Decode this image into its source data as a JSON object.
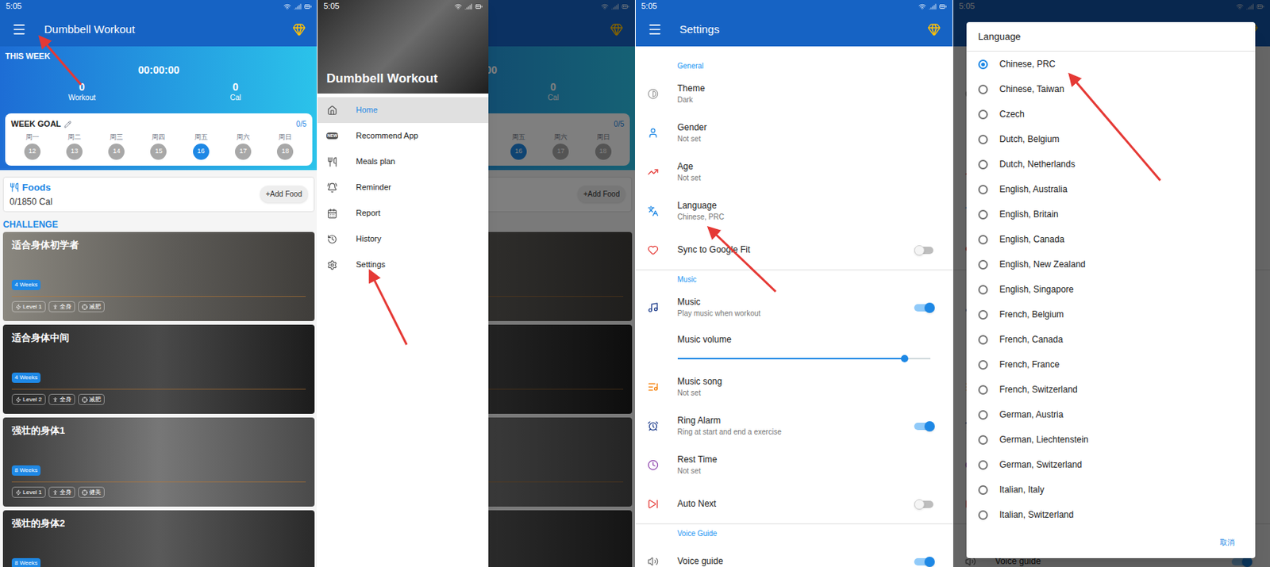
{
  "status_bar": {
    "time": "5:05"
  },
  "home": {
    "title": "Dumbbell Workout",
    "this_week": {
      "label": "THIS WEEK",
      "duration": "00:00:00",
      "stats": [
        {
          "value": "0",
          "label": "Workout"
        },
        {
          "value": "0",
          "label": "Cal"
        }
      ]
    },
    "week_goal": {
      "label": "WEEK GOAL",
      "progress": "0/5",
      "days": [
        {
          "name": "周一",
          "date": "12",
          "selected": false
        },
        {
          "name": "周二",
          "date": "13",
          "selected": false
        },
        {
          "name": "周三",
          "date": "14",
          "selected": false
        },
        {
          "name": "周四",
          "date": "15",
          "selected": false
        },
        {
          "name": "周五",
          "date": "16",
          "selected": true
        },
        {
          "name": "周六",
          "date": "17",
          "selected": false
        },
        {
          "name": "周日",
          "date": "18",
          "selected": false
        }
      ]
    },
    "foods": {
      "label": "Foods",
      "calories": "0/1850 Cal",
      "button": "+Add Food"
    },
    "challenge": {
      "label": "CHALLENGE",
      "cards": [
        {
          "title": "适合身体初学者",
          "duration": "4 Weeks",
          "tags": [
            "Level 1",
            "全身",
            "减肥"
          ]
        },
        {
          "title": "适合身体中间",
          "duration": "4 Weeks",
          "tags": [
            "Level 2",
            "全身",
            "减肥"
          ]
        },
        {
          "title": "强壮的身体1",
          "duration": "8 Weeks",
          "tags": [
            "Level 1",
            "全身",
            "健美"
          ]
        },
        {
          "title": "强壮的身体2",
          "duration": "8 Weeks",
          "tags": []
        }
      ]
    }
  },
  "drawer": {
    "title": "Dumbbell Workout",
    "items": [
      {
        "label": "Home",
        "selected": true
      },
      {
        "label": "Recommend App",
        "selected": false,
        "icon_text": "NEW"
      },
      {
        "label": "Meals plan",
        "selected": false
      },
      {
        "label": "Reminder",
        "selected": false
      },
      {
        "label": "Report",
        "selected": false
      },
      {
        "label": "History",
        "selected": false
      },
      {
        "label": "Settings",
        "selected": false
      }
    ]
  },
  "settings": {
    "title": "Settings",
    "sections": [
      {
        "header": "General",
        "rows": [
          {
            "kind": "value",
            "label": "Theme",
            "value": "Dark"
          },
          {
            "kind": "value",
            "label": "Gender",
            "value": "Not set"
          },
          {
            "kind": "value",
            "label": "Age",
            "value": "Not set"
          },
          {
            "kind": "value",
            "label": "Language",
            "value": "Chinese, PRC"
          },
          {
            "kind": "toggle",
            "label": "Sync to Google Fit",
            "value": "",
            "on": false
          }
        ]
      },
      {
        "header": "Music",
        "rows": [
          {
            "kind": "toggle",
            "label": "Music",
            "value": "Play music when workout",
            "on": true
          },
          {
            "kind": "slider",
            "label": "Music volume",
            "level": 0.9
          },
          {
            "kind": "value",
            "label": "Music song",
            "value": "Not set"
          },
          {
            "kind": "toggle",
            "label": "Ring Alarm",
            "value": "Ring at start and end a exercise",
            "on": true
          },
          {
            "kind": "value",
            "label": "Rest Time",
            "value": "Not set"
          },
          {
            "kind": "toggle",
            "label": "Auto Next",
            "value": "",
            "on": false
          }
        ]
      },
      {
        "header": "Voice Guide",
        "rows": [
          {
            "kind": "toggle",
            "label": "Voice guide",
            "value": "",
            "on": true
          }
        ]
      }
    ]
  },
  "language_dialog": {
    "title": "Language",
    "options": [
      {
        "label": "Chinese, PRC",
        "selected": true
      },
      {
        "label": "Chinese, Taiwan",
        "selected": false
      },
      {
        "label": "Czech",
        "selected": false
      },
      {
        "label": "Dutch, Belgium",
        "selected": false
      },
      {
        "label": "Dutch, Netherlands",
        "selected": false
      },
      {
        "label": "English, Australia",
        "selected": false
      },
      {
        "label": "English, Britain",
        "selected": false
      },
      {
        "label": "English, Canada",
        "selected": false
      },
      {
        "label": "English, New Zealand",
        "selected": false
      },
      {
        "label": "English, Singapore",
        "selected": false
      },
      {
        "label": "French, Belgium",
        "selected": false
      },
      {
        "label": "French, Canada",
        "selected": false
      },
      {
        "label": "French, France",
        "selected": false
      },
      {
        "label": "French, Switzerland",
        "selected": false
      },
      {
        "label": "German, Austria",
        "selected": false
      },
      {
        "label": "German, Liechtenstein",
        "selected": false
      },
      {
        "label": "German, Switzerland",
        "selected": false
      },
      {
        "label": "Italian, Italy",
        "selected": false
      },
      {
        "label": "Italian, Switzerland",
        "selected": false
      }
    ],
    "cancel": "取消"
  }
}
